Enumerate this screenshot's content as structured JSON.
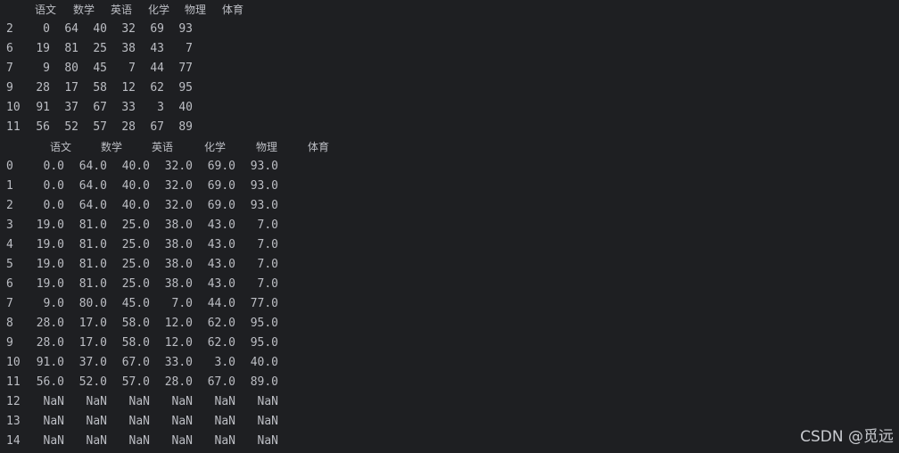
{
  "df1": {
    "columns": [
      "语文",
      "数学",
      "英语",
      "化学",
      "物理",
      "体育"
    ],
    "rows": [
      {
        "index": "2",
        "values": [
          "0",
          "64",
          "40",
          "32",
          "69",
          "93"
        ]
      },
      {
        "index": "6",
        "values": [
          "19",
          "81",
          "25",
          "38",
          "43",
          "7"
        ]
      },
      {
        "index": "7",
        "values": [
          "9",
          "80",
          "45",
          "7",
          "44",
          "77"
        ]
      },
      {
        "index": "9",
        "values": [
          "28",
          "17",
          "58",
          "12",
          "62",
          "95"
        ]
      },
      {
        "index": "10",
        "values": [
          "91",
          "37",
          "67",
          "33",
          "3",
          "40"
        ]
      },
      {
        "index": "11",
        "values": [
          "56",
          "52",
          "57",
          "28",
          "67",
          "89"
        ]
      }
    ]
  },
  "df2": {
    "columns": [
      "语文",
      "数学",
      "英语",
      "化学",
      "物理",
      "体育"
    ],
    "rows": [
      {
        "index": "0",
        "values": [
          "0.0",
          "64.0",
          "40.0",
          "32.0",
          "69.0",
          "93.0"
        ]
      },
      {
        "index": "1",
        "values": [
          "0.0",
          "64.0",
          "40.0",
          "32.0",
          "69.0",
          "93.0"
        ]
      },
      {
        "index": "2",
        "values": [
          "0.0",
          "64.0",
          "40.0",
          "32.0",
          "69.0",
          "93.0"
        ]
      },
      {
        "index": "3",
        "values": [
          "19.0",
          "81.0",
          "25.0",
          "38.0",
          "43.0",
          "7.0"
        ]
      },
      {
        "index": "4",
        "values": [
          "19.0",
          "81.0",
          "25.0",
          "38.0",
          "43.0",
          "7.0"
        ]
      },
      {
        "index": "5",
        "values": [
          "19.0",
          "81.0",
          "25.0",
          "38.0",
          "43.0",
          "7.0"
        ]
      },
      {
        "index": "6",
        "values": [
          "19.0",
          "81.0",
          "25.0",
          "38.0",
          "43.0",
          "7.0"
        ]
      },
      {
        "index": "7",
        "values": [
          "9.0",
          "80.0",
          "45.0",
          "7.0",
          "44.0",
          "77.0"
        ]
      },
      {
        "index": "8",
        "values": [
          "28.0",
          "17.0",
          "58.0",
          "12.0",
          "62.0",
          "95.0"
        ]
      },
      {
        "index": "9",
        "values": [
          "28.0",
          "17.0",
          "58.0",
          "12.0",
          "62.0",
          "95.0"
        ]
      },
      {
        "index": "10",
        "values": [
          "91.0",
          "37.0",
          "67.0",
          "33.0",
          "3.0",
          "40.0"
        ]
      },
      {
        "index": "11",
        "values": [
          "56.0",
          "52.0",
          "57.0",
          "28.0",
          "67.0",
          "89.0"
        ]
      },
      {
        "index": "12",
        "values": [
          "NaN",
          "NaN",
          "NaN",
          "NaN",
          "NaN",
          "NaN"
        ]
      },
      {
        "index": "13",
        "values": [
          "NaN",
          "NaN",
          "NaN",
          "NaN",
          "NaN",
          "NaN"
        ]
      },
      {
        "index": "14",
        "values": [
          "NaN",
          "NaN",
          "NaN",
          "NaN",
          "NaN",
          "NaN"
        ]
      }
    ]
  },
  "watermark": "CSDN @觅远",
  "colors": {
    "background": "#1e1f22",
    "text": "#bcbec4"
  }
}
